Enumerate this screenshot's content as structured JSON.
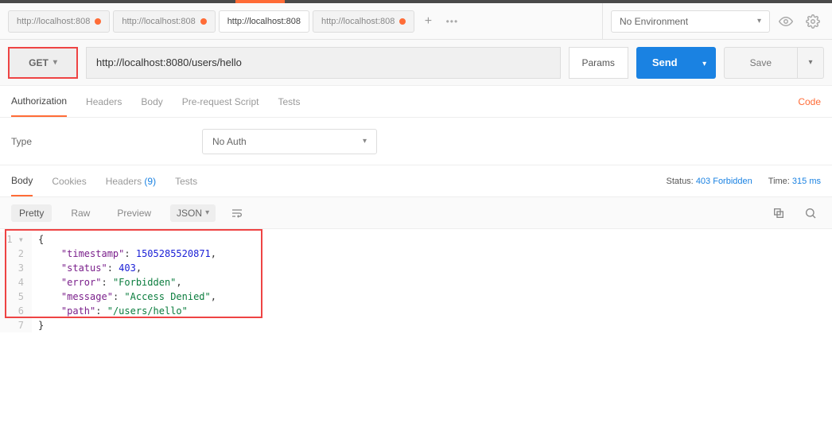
{
  "env": {
    "label": "No Environment"
  },
  "tabs": [
    {
      "label": "http://localhost:808",
      "dirty": true,
      "active": false
    },
    {
      "label": "http://localhost:808",
      "dirty": true,
      "active": false
    },
    {
      "label": "http://localhost:808",
      "dirty": false,
      "active": true
    },
    {
      "label": "http://localhost:808",
      "dirty": true,
      "active": false
    }
  ],
  "request": {
    "method": "GET",
    "url": "http://localhost:8080/users/hello",
    "params_label": "Params",
    "send_label": "Send",
    "save_label": "Save"
  },
  "subtabs": {
    "authorization": "Authorization",
    "headers": "Headers",
    "body": "Body",
    "prerequest": "Pre-request Script",
    "tests": "Tests",
    "code": "Code"
  },
  "auth": {
    "type_label": "Type",
    "value": "No Auth"
  },
  "response_tabs": {
    "body": "Body",
    "cookies": "Cookies",
    "headers": "Headers",
    "headers_count": "(9)",
    "tests": "Tests"
  },
  "status": {
    "label": "Status:",
    "value": "403 Forbidden"
  },
  "time": {
    "label": "Time:",
    "value": "315 ms"
  },
  "view": {
    "pretty": "Pretty",
    "raw": "Raw",
    "preview": "Preview",
    "format": "JSON"
  },
  "response_json": {
    "timestamp": 1505285520871,
    "status": 403,
    "error": "Forbidden",
    "message": "Access Denied",
    "path": "/users/hello"
  },
  "lines": {
    "l1": "{",
    "l2_key": "\"timestamp\"",
    "l2_val": "1505285520871",
    "l3_key": "\"status\"",
    "l3_val": "403",
    "l4_key": "\"error\"",
    "l4_val": "\"Forbidden\"",
    "l5_key": "\"message\"",
    "l5_val": "\"Access Denied\"",
    "l6_key": "\"path\"",
    "l6_val": "\"/users/hello\"",
    "l7": "}"
  }
}
